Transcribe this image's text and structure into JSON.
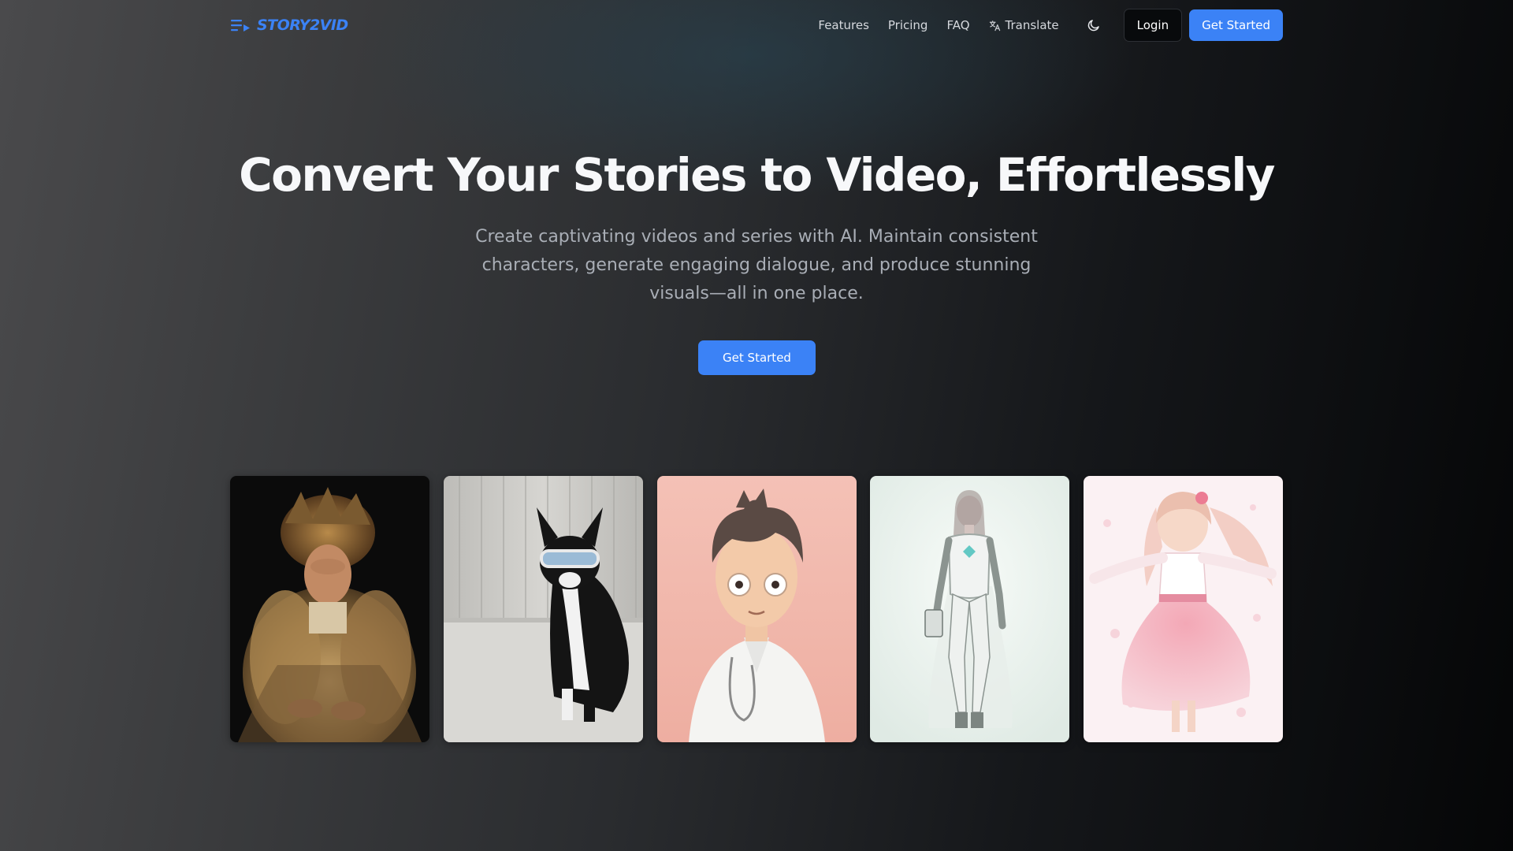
{
  "brand": {
    "name": "STORY2VID",
    "accent_color": "#3b82f6",
    "logo_icon": "playlist-play-icon"
  },
  "nav": {
    "links": [
      "Features",
      "Pricing",
      "FAQ"
    ],
    "translate_label": "Translate",
    "translate_icon": "translate-icon",
    "theme_icon": "moon-icon",
    "login_label": "Login",
    "cta_label": "Get Started"
  },
  "hero": {
    "title": "Convert Your Stories to Video, Effortlessly",
    "subtitle": "Create captivating videos and series with AI. Maintain consistent characters, generate engaging dialogue, and produce stunning visuals—all in one place.",
    "cta_label": "Get Started"
  },
  "gallery": [
    {
      "subject": "portrait-fur-coat-woman",
      "background": "#0b0b0b"
    },
    {
      "subject": "boston-terrier-with-goggles",
      "background": "#cfcfcc"
    },
    {
      "subject": "cartoon-doctor-character",
      "background": "#f1b9ae"
    },
    {
      "subject": "white-android-robot-woman",
      "background": "#eef4f0"
    },
    {
      "subject": "anime-girl-pink-dress",
      "background": "#fbf0f2"
    }
  ]
}
